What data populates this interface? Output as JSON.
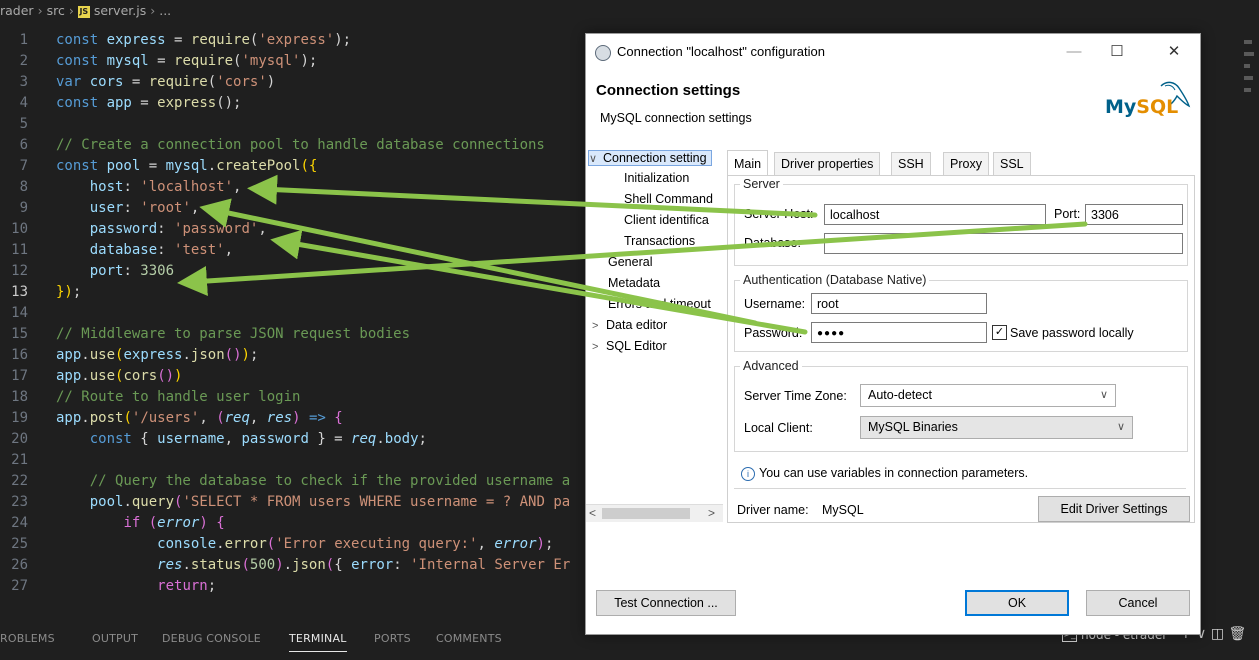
{
  "editor": {
    "breadcrumb": [
      "rader",
      "src",
      "server.js",
      "..."
    ],
    "lines": [
      {
        "n": "1",
        "tokens": [
          [
            "k",
            "const "
          ],
          [
            "v",
            "express"
          ],
          [
            "p",
            " = "
          ],
          [
            "f",
            "require"
          ],
          [
            "p",
            "("
          ],
          [
            "s",
            "'express'"
          ],
          [
            "p",
            ");"
          ]
        ]
      },
      {
        "n": "2",
        "tokens": [
          [
            "k",
            "const "
          ],
          [
            "v",
            "mysql"
          ],
          [
            "p",
            " = "
          ],
          [
            "f",
            "require"
          ],
          [
            "p",
            "("
          ],
          [
            "s",
            "'mysql'"
          ],
          [
            "p",
            ");"
          ]
        ]
      },
      {
        "n": "3",
        "tokens": [
          [
            "k",
            "var "
          ],
          [
            "v",
            "cors"
          ],
          [
            "p",
            " = "
          ],
          [
            "f",
            "require"
          ],
          [
            "p",
            "("
          ],
          [
            "s",
            "'cors'"
          ],
          [
            "p",
            ")"
          ]
        ]
      },
      {
        "n": "4",
        "tokens": [
          [
            "k",
            "const "
          ],
          [
            "v",
            "app"
          ],
          [
            "p",
            " = "
          ],
          [
            "f",
            "express"
          ],
          [
            "p",
            "();"
          ]
        ]
      },
      {
        "n": "5",
        "tokens": []
      },
      {
        "n": "6",
        "tokens": [
          [
            "c",
            "// Create a connection pool to handle database connections"
          ]
        ]
      },
      {
        "n": "7",
        "tokens": [
          [
            "k",
            "const "
          ],
          [
            "v",
            "pool"
          ],
          [
            "p",
            " = "
          ],
          [
            "v",
            "mysql"
          ],
          [
            "p",
            "."
          ],
          [
            "f",
            "createPool"
          ],
          [
            "y",
            "({"
          ]
        ]
      },
      {
        "n": "8",
        "tokens": [
          [
            "p",
            "    "
          ],
          [
            "v",
            "host"
          ],
          [
            "p",
            ": "
          ],
          [
            "s",
            "'localhost'"
          ],
          [
            "p",
            ","
          ]
        ]
      },
      {
        "n": "9",
        "tokens": [
          [
            "p",
            "    "
          ],
          [
            "v",
            "user"
          ],
          [
            "p",
            ": "
          ],
          [
            "s",
            "'root'"
          ],
          [
            "p",
            ","
          ]
        ]
      },
      {
        "n": "10",
        "tokens": [
          [
            "p",
            "    "
          ],
          [
            "v",
            "password"
          ],
          [
            "p",
            ": "
          ],
          [
            "s",
            "'password'"
          ],
          [
            "p",
            ","
          ]
        ]
      },
      {
        "n": "11",
        "tokens": [
          [
            "p",
            "    "
          ],
          [
            "v",
            "database"
          ],
          [
            "p",
            ": "
          ],
          [
            "s",
            "'test'"
          ],
          [
            "p",
            ","
          ]
        ]
      },
      {
        "n": "12",
        "tokens": [
          [
            "p",
            "    "
          ],
          [
            "v",
            "port"
          ],
          [
            "p",
            ": "
          ],
          [
            "n",
            "3306"
          ]
        ]
      },
      {
        "n": "13",
        "tokens": [
          [
            "y",
            "})"
          ],
          [
            "p",
            ";"
          ]
        ]
      },
      {
        "n": "14",
        "tokens": []
      },
      {
        "n": "15",
        "tokens": [
          [
            "c",
            "// Middleware to parse JSON request bodies"
          ]
        ]
      },
      {
        "n": "16",
        "tokens": [
          [
            "v",
            "app"
          ],
          [
            "p",
            "."
          ],
          [
            "f",
            "use"
          ],
          [
            "y",
            "("
          ],
          [
            "v",
            "express"
          ],
          [
            "p",
            "."
          ],
          [
            "f",
            "json"
          ],
          [
            "pu",
            "()"
          ],
          [
            "y",
            ")"
          ],
          [
            "p",
            ";"
          ]
        ]
      },
      {
        "n": "17",
        "tokens": [
          [
            "v",
            "app"
          ],
          [
            "p",
            "."
          ],
          [
            "f",
            "use"
          ],
          [
            "y",
            "("
          ],
          [
            "f",
            "cors"
          ],
          [
            "pu",
            "()"
          ],
          [
            "y",
            ")"
          ]
        ]
      },
      {
        "n": "18",
        "tokens": [
          [
            "c",
            "// Route to handle user login"
          ]
        ]
      },
      {
        "n": "19",
        "tokens": [
          [
            "v",
            "app"
          ],
          [
            "p",
            "."
          ],
          [
            "f",
            "post"
          ],
          [
            "y",
            "("
          ],
          [
            "s",
            "'/users'"
          ],
          [
            "p",
            ", "
          ],
          [
            "pu",
            "("
          ],
          [
            "pr",
            "req"
          ],
          [
            "p",
            ", "
          ],
          [
            "pr",
            "res"
          ],
          [
            "pu",
            ")"
          ],
          [
            "p",
            " "
          ],
          [
            "k",
            "=>"
          ],
          [
            "p",
            " "
          ],
          [
            "pu",
            "{"
          ]
        ]
      },
      {
        "n": "20",
        "tokens": [
          [
            "p",
            "    "
          ],
          [
            "k",
            "const "
          ],
          [
            "p",
            "{ "
          ],
          [
            "v",
            "username"
          ],
          [
            "p",
            ", "
          ],
          [
            "v",
            "password"
          ],
          [
            "p",
            " } = "
          ],
          [
            "pr",
            "req"
          ],
          [
            "p",
            "."
          ],
          [
            "v",
            "body"
          ],
          [
            "p",
            ";"
          ]
        ]
      },
      {
        "n": "21",
        "tokens": []
      },
      {
        "n": "22",
        "tokens": [
          [
            "p",
            "    "
          ],
          [
            "c",
            "// Query the database to check if the provided username a"
          ]
        ]
      },
      {
        "n": "23",
        "tokens": [
          [
            "p",
            "    "
          ],
          [
            "v",
            "pool"
          ],
          [
            "p",
            "."
          ],
          [
            "f",
            "query"
          ],
          [
            "pu",
            "("
          ],
          [
            "s",
            "'SELECT * FROM users WHERE username = ? AND pa"
          ]
        ]
      },
      {
        "n": "24",
        "tokens": [
          [
            "p",
            "        "
          ],
          [
            "pu",
            "if "
          ],
          [
            "pu",
            "("
          ],
          [
            "pr",
            "error"
          ],
          [
            "pu",
            ")"
          ],
          [
            "p",
            " "
          ],
          [
            "pu",
            "{"
          ]
        ]
      },
      {
        "n": "25",
        "tokens": [
          [
            "p",
            "            "
          ],
          [
            "v",
            "console"
          ],
          [
            "p",
            "."
          ],
          [
            "f",
            "error"
          ],
          [
            "pu",
            "("
          ],
          [
            "s",
            "'Error executing query:'"
          ],
          [
            "p",
            ", "
          ],
          [
            "pr",
            "error"
          ],
          [
            "pu",
            ")"
          ],
          [
            "p",
            ";"
          ]
        ]
      },
      {
        "n": "26",
        "tokens": [
          [
            "p",
            "            "
          ],
          [
            "pr",
            "res"
          ],
          [
            "p",
            "."
          ],
          [
            "f",
            "status"
          ],
          [
            "pu",
            "("
          ],
          [
            "n",
            "500"
          ],
          [
            "pu",
            ")"
          ],
          [
            "p",
            "."
          ],
          [
            "f",
            "json"
          ],
          [
            "pu",
            "("
          ],
          [
            "p",
            "{ "
          ],
          [
            "v",
            "error"
          ],
          [
            "p",
            ": "
          ],
          [
            "s",
            "'Internal Server Er"
          ]
        ]
      },
      {
        "n": "27",
        "tokens": [
          [
            "p",
            "            "
          ],
          [
            "pu",
            "return"
          ],
          [
            "p",
            ";"
          ]
        ]
      }
    ],
    "active_line": "13"
  },
  "panel": {
    "tabs": [
      "ROBLEMS",
      "OUTPUT",
      "DEBUG CONSOLE",
      "TERMINAL",
      "PORTS",
      "COMMENTS"
    ],
    "active_tab": "TERMINAL",
    "terminal_name": "node - etrader",
    "terminal_glyph": ">_",
    "actions": "+ ∨  ◫  🗑"
  },
  "dialog": {
    "title": "Connection \"localhost\" configuration",
    "window_buttons": {
      "minimize": "—",
      "maximize": "☐",
      "close": "✕"
    },
    "header_title": "Connection settings",
    "header_subtitle": "MySQL connection settings",
    "logo": {
      "text_main": "My",
      "text_accent": "SQL"
    },
    "tree": [
      {
        "label": "Connection setting",
        "chevron": "∨",
        "selected": true
      },
      {
        "label": "Initialization"
      },
      {
        "label": "Shell Command"
      },
      {
        "label": "Client identifica"
      },
      {
        "label": "Transactions"
      },
      {
        "label": "General"
      },
      {
        "label": "Metadata"
      },
      {
        "label": "Errors and timeout"
      },
      {
        "label": "Data editor",
        "chevron": ">"
      },
      {
        "label": "SQL Editor",
        "chevron": ">"
      }
    ],
    "tree_scroll": {
      "left": "<",
      "right": ">"
    },
    "tabs": [
      "Main",
      "Driver properties",
      "SSH",
      "Proxy",
      "SSL"
    ],
    "active_tab": "Main",
    "server": {
      "group_title": "Server",
      "host_label": "Server Host:",
      "host_value": "localhost",
      "port_label": "Port:",
      "port_value": "3306",
      "database_label": "Database:",
      "database_value": ""
    },
    "auth": {
      "group_title": "Authentication (Database Native)",
      "username_label": "Username:",
      "username_value": "root",
      "password_label": "Password:",
      "password_value": "●●●●",
      "save_password_label": "Save password locally",
      "save_password_checked": "✓"
    },
    "advanced": {
      "group_title": "Advanced",
      "timezone_label": "Server Time Zone:",
      "timezone_value": "Auto-detect",
      "client_label": "Local Client:",
      "client_value": "MySQL Binaries"
    },
    "info_text": "You can use variables in connection parameters.",
    "info_glyph": "i",
    "driver_label": "Driver name:",
    "driver_value": "MySQL",
    "edit_driver_button": "Edit Driver Settings",
    "test_button": "Test Connection ...",
    "ok_button": "OK",
    "cancel_button": "Cancel",
    "arrow_color": "#8bc34a"
  }
}
